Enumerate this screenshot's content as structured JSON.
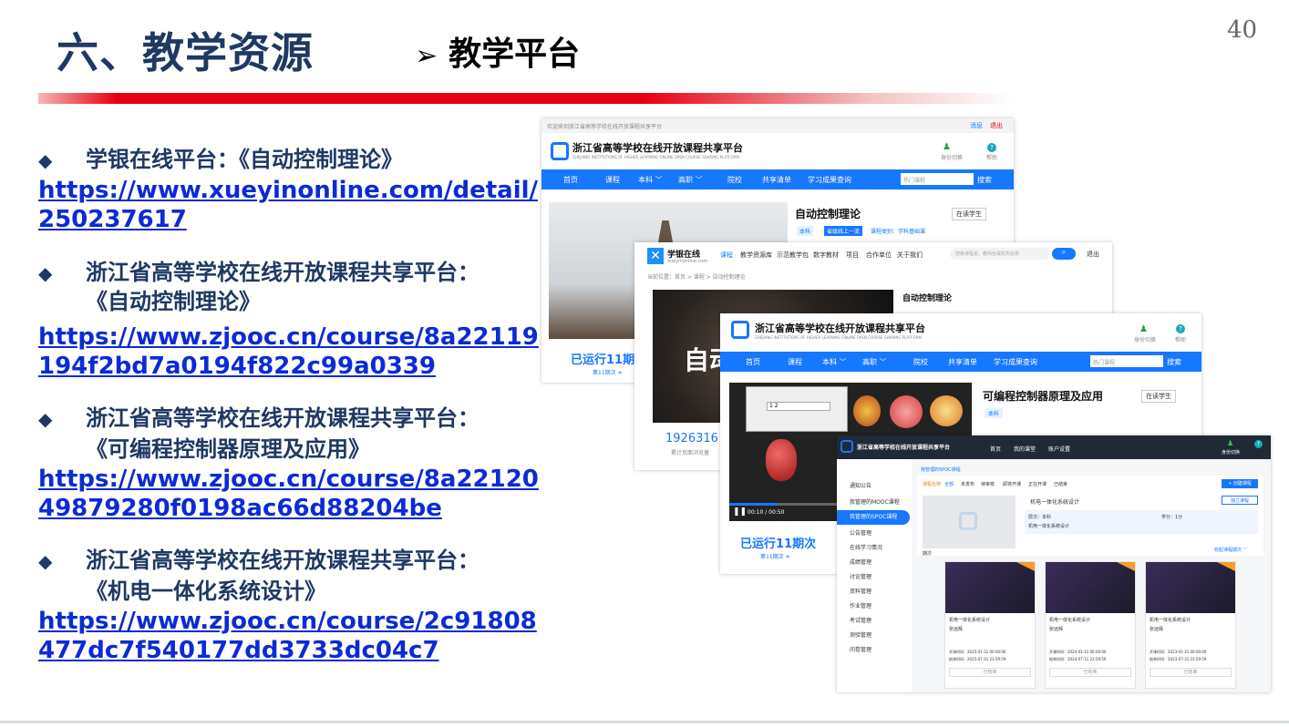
{
  "header": {
    "title": "六、教学资源",
    "subtitle_arrow": "➢",
    "subtitle": "教学平台",
    "page_number": "40"
  },
  "colors": {
    "title": "#1f3864",
    "link": "#0b2bd6",
    "accent": "#e60012",
    "platform_blue": "#1677ff"
  },
  "items": [
    {
      "bullet": "◆",
      "title_lines": [
        "学银在线平台：《自动控制理论》"
      ],
      "link_lines": [
        "https://www.xueyinonline.com/detail/",
        "250237617"
      ]
    },
    {
      "bullet": "◆",
      "title_lines": [
        "浙江省高等学校在线开放课程共享平台：",
        "《自动控制理论》"
      ],
      "link_lines": [
        "https://www.zjooc.cn/course/8a22119",
        "194f2bd7a0194f822c99a0339"
      ]
    },
    {
      "bullet": "◆",
      "title_lines": [
        "浙江省高等学校在线开放课程共享平台：",
        "《可编程控制器原理及应用》"
      ],
      "link_lines": [
        "https://www.zjooc.cn/course/8a22120",
        "49879280f0198ac66d88204be"
      ]
    },
    {
      "bullet": "◆",
      "title_lines": [
        "浙江省高等学校在线开放课程共享平台：",
        "《机电一体化系统设计》"
      ],
      "link_lines": [
        "https://www.zjooc.cn/course/2c91808",
        "477dc7f540177dd3733dc04c7"
      ]
    }
  ],
  "shot1": {
    "topbar_text": "欢迎来到浙江省高等学校在线开放课程共享平台",
    "login": "消息",
    "logout": "退出",
    "platform_name": "浙江省高等学校在线开放课程共享平台",
    "platform_en": "ZHEJIANG INSTITUTIONS OF HIGHER LEARNING ONLINE OPEN COURSE SHARING PLATFORM",
    "switch": "身份切换",
    "help": "帮助",
    "nav": [
      "首页",
      "课程",
      "本科 ﹀",
      "高职 ﹀",
      "院校",
      "共享清单",
      "学习成果查询"
    ],
    "search_placeholder": "热门课程",
    "search_btn": "搜索",
    "course_title": "自动控制理论",
    "learning": "在读学生",
    "tags": [
      "本科",
      "省级线上一流",
      "课程类别：学科基础课"
    ],
    "runs": "已运行11期次",
    "runs_sub": "第11期次 ≑"
  },
  "shot2": {
    "brand": "学银在线",
    "brand_sub": "xueyinonline.com",
    "nav": [
      "课程",
      "教学资源库",
      "示范教学包",
      "数字教材",
      "项目",
      "合作单位",
      "关于我们"
    ],
    "search_placeholder": "搜索课程名、教师名或机构名称",
    "user": "退出",
    "breadcrumb": "当前位置：首页 > 课程 > 自动控制理论",
    "course_title": "自动控制理论",
    "visits": "1926316",
    "visits_label": "累计页面浏览量",
    "photo_text": "自动"
  },
  "shot3": {
    "platform_name": "浙江省高等学校在线开放课程共享平台",
    "platform_en": "ZHEJIANG INSTITUTIONS OF HIGHER LEARNING ONLINE OPEN COURSE SHARING PLATFORM",
    "switch": "身份切换",
    "help": "帮助",
    "nav": [
      "首页",
      "课程",
      "本科 ﹀",
      "高职 ﹀",
      "院校",
      "共享清单",
      "学习成果查询"
    ],
    "search_placeholder": "热门课程",
    "search_btn": "搜索",
    "course_title": "可编程控制器原理及应用",
    "learning": "在读学生",
    "tag": "本科",
    "video_time": "00:10 / 00:50",
    "runs": "已运行11期次",
    "runs_sub": "第11期次 ≑",
    "dialog_value": "1 2"
  },
  "shot4": {
    "platform_name": "浙江省高等学校在线开放课程共享平台",
    "nav": [
      "首页",
      "我的课堂",
      "账户设置"
    ],
    "switch": "身份切换",
    "sidebar": [
      "通知公告",
      "我管理的MOOC课程",
      "我管理的SPOC课程",
      "公告管理",
      "在线学习情况",
      "成绩管理",
      "讨论管理",
      "资料管理",
      "作业管理",
      "考试管理",
      "测验管理",
      "问卷管理"
    ],
    "breadcrumb": "我管理的SPOC课程",
    "filters": [
      "课程名称",
      "全部",
      "未发布",
      "待审核",
      "即将开课",
      "正在开课",
      "已结束"
    ],
    "new_btn": "+ 创建课程",
    "course_name": "机电一体化系统设计",
    "level": "层次：本科",
    "credit": "学分：1分",
    "course_sub": "机电一体化系统设计",
    "publish_btn": "独立课程",
    "link_more": "收起课程期次 ﹀",
    "section": "期次",
    "cards": [
      {
        "title": "机电一体化系统设计",
        "teacher": "张远辉",
        "start": "开课时间：2025-01-31 00:00:00",
        "end": "结束时间：2025-07-31 23:59:59",
        "status": "已结束"
      },
      {
        "title": "机电一体化系统设计",
        "teacher": "张远辉",
        "start": "开课时间：2024-01-31 00:00:00",
        "end": "结束时间：2024-07-31 23:59:59",
        "status": "已结束"
      },
      {
        "title": "机电一体化系统设计",
        "teacher": "张远辉",
        "start": "开课时间：2023-01-31 00:00:00",
        "end": "结束时间：2023-07-31 23:59:59",
        "status": "已结束"
      }
    ]
  }
}
